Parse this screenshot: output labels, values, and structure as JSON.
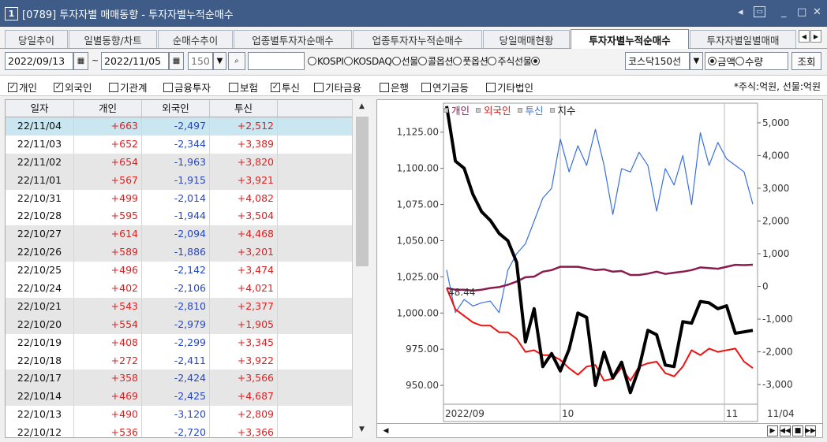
{
  "window": {
    "number": "1",
    "title": "[0789] 투자자별 매매동향 - 투자자별누적순매수"
  },
  "tabs": [
    {
      "label": "당일추이",
      "active": false
    },
    {
      "label": "일별동향/차트",
      "active": false
    },
    {
      "label": "순매수추이",
      "active": false
    },
    {
      "label": "업종별투자자순매수",
      "active": false
    },
    {
      "label": "업종투자자누적순매수",
      "active": false
    },
    {
      "label": "당일매매현황",
      "active": false
    },
    {
      "label": "투자자별누적순매수",
      "active": true
    },
    {
      "label": "투자자별일별매매",
      "active": false
    }
  ],
  "toolbar": {
    "start_date": "2022/09/13",
    "separator": "~",
    "end_date": "2022/11/05",
    "count": "150",
    "code": "",
    "market_options": [
      "KOSPI",
      "KOSDAQ",
      "선물",
      "콜옵션",
      "풋옵션",
      "주식선물",
      "코스닥150선"
    ],
    "market_selected": "코스닥150선",
    "type_options": [
      "금액",
      "수량"
    ],
    "type_selected": "금액",
    "query_label": "조회"
  },
  "investors": [
    {
      "label": "개인",
      "checked": true
    },
    {
      "label": "외국인",
      "checked": true
    },
    {
      "label": "기관계",
      "checked": false
    },
    {
      "label": "금융투자",
      "checked": false
    },
    {
      "label": "보험",
      "checked": false
    },
    {
      "label": "투신",
      "checked": true
    },
    {
      "label": "기타금융",
      "checked": false
    },
    {
      "label": "은행",
      "checked": false
    },
    {
      "label": "연기금등",
      "checked": false
    },
    {
      "label": "기타법인",
      "checked": false
    }
  ],
  "unit_note": "*주식:억원, 선물:억원",
  "table": {
    "headers": [
      "일자",
      "개인",
      "외국인",
      "투신"
    ],
    "rows": [
      [
        "22/11/04",
        "+663",
        "-2,497",
        "+2,512"
      ],
      [
        "22/11/03",
        "+652",
        "-2,344",
        "+3,389"
      ],
      [
        "22/11/02",
        "+654",
        "-1,963",
        "+3,820"
      ],
      [
        "22/11/01",
        "+567",
        "-1,915",
        "+3,921"
      ],
      [
        "22/10/31",
        "+499",
        "-2,014",
        "+4,082"
      ],
      [
        "22/10/28",
        "+595",
        "-1,944",
        "+3,504"
      ],
      [
        "22/10/27",
        "+614",
        "-2,094",
        "+4,468"
      ],
      [
        "22/10/26",
        "+589",
        "-1,886",
        "+3,201"
      ],
      [
        "22/10/25",
        "+496",
        "-2,142",
        "+3,474"
      ],
      [
        "22/10/24",
        "+402",
        "-2,106",
        "+4,021"
      ],
      [
        "22/10/21",
        "+543",
        "-2,810",
        "+2,377"
      ],
      [
        "22/10/20",
        "+554",
        "-2,979",
        "+1,905"
      ],
      [
        "22/10/19",
        "+408",
        "-2,299",
        "+3,345"
      ],
      [
        "22/10/18",
        "+272",
        "-2,411",
        "+3,922"
      ],
      [
        "22/10/17",
        "+358",
        "-2,424",
        "+3,566"
      ],
      [
        "22/10/14",
        "+469",
        "-2,425",
        "+4,687"
      ],
      [
        "22/10/13",
        "+490",
        "-3,120",
        "+2,809"
      ],
      [
        "22/10/12",
        "+536",
        "-2,720",
        "+3,366"
      ]
    ]
  },
  "chart_data": {
    "type": "line",
    "legend": [
      "개인",
      "외국인",
      "투신",
      "지수"
    ],
    "colors": {
      "개인": "#8b1a4e",
      "외국인": "#ee1111",
      "투신": "#3a6fe0",
      "지수": "#000000"
    },
    "left_axis_ticks": [
      "1,125.00",
      "1,100.00",
      "1,075.00",
      "1,050.00",
      "1,025.00",
      "1,000.00",
      "975.00",
      "950.00"
    ],
    "right_axis_ticks": [
      "5,000",
      "4,000",
      "3,000",
      "2,000",
      "1,000",
      "0",
      "-1,000",
      "-2,000",
      "-3,000"
    ],
    "left_ylim": [
      937,
      1145
    ],
    "right_ylim": [
      -3600,
      5600
    ],
    "x_labels": [
      "2022/09",
      "10",
      "11",
      "11/04"
    ],
    "marker_label": "48.44",
    "series": [
      {
        "name": "지수",
        "axis": "left",
        "values": [
          1143,
          1105,
          1100,
          1082,
          1070,
          1064,
          1055,
          1050,
          1035,
          980,
          1003,
          963,
          972,
          960,
          975,
          1000,
          997,
          950,
          973,
          955,
          966,
          945,
          962,
          988,
          985,
          964,
          963,
          994,
          993,
          1008,
          1007,
          1003,
          1005,
          986,
          987,
          988
        ]
      },
      {
        "name": "개인",
        "axis": "right",
        "values": [
          -50,
          -100,
          -100,
          -130,
          -100,
          -50,
          -20,
          50,
          150,
          280,
          300,
          450,
          500,
          600,
          600,
          600,
          550,
          500,
          520,
          450,
          470,
          350,
          350,
          390,
          450,
          380,
          420,
          450,
          500,
          580,
          560,
          540,
          600,
          660,
          650,
          663
        ]
      },
      {
        "name": "외국인",
        "axis": "right",
        "values": [
          -50,
          -700,
          -900,
          -1100,
          -1200,
          -1200,
          -1400,
          -1400,
          -1600,
          -2000,
          -1950,
          -2100,
          -2100,
          -2250,
          -2500,
          -2700,
          -2450,
          -2400,
          -2880,
          -2820,
          -2480,
          -2880,
          -2450,
          -2350,
          -2300,
          -2650,
          -2750,
          -2450,
          -1950,
          -2100,
          -1900,
          -2000,
          -1950,
          -1900,
          -2300,
          -2497
        ]
      },
      {
        "name": "투신",
        "axis": "right",
        "values": [
          500,
          -800,
          -400,
          -600,
          -500,
          -450,
          -800,
          500,
          1000,
          1300,
          2000,
          2700,
          3000,
          4500,
          3500,
          4300,
          3700,
          4800,
          3700,
          2200,
          3600,
          3500,
          4100,
          3700,
          2300,
          3600,
          3100,
          4000,
          2500,
          4700,
          3700,
          4400,
          3900,
          3700,
          3500,
          2512
        ]
      }
    ]
  }
}
